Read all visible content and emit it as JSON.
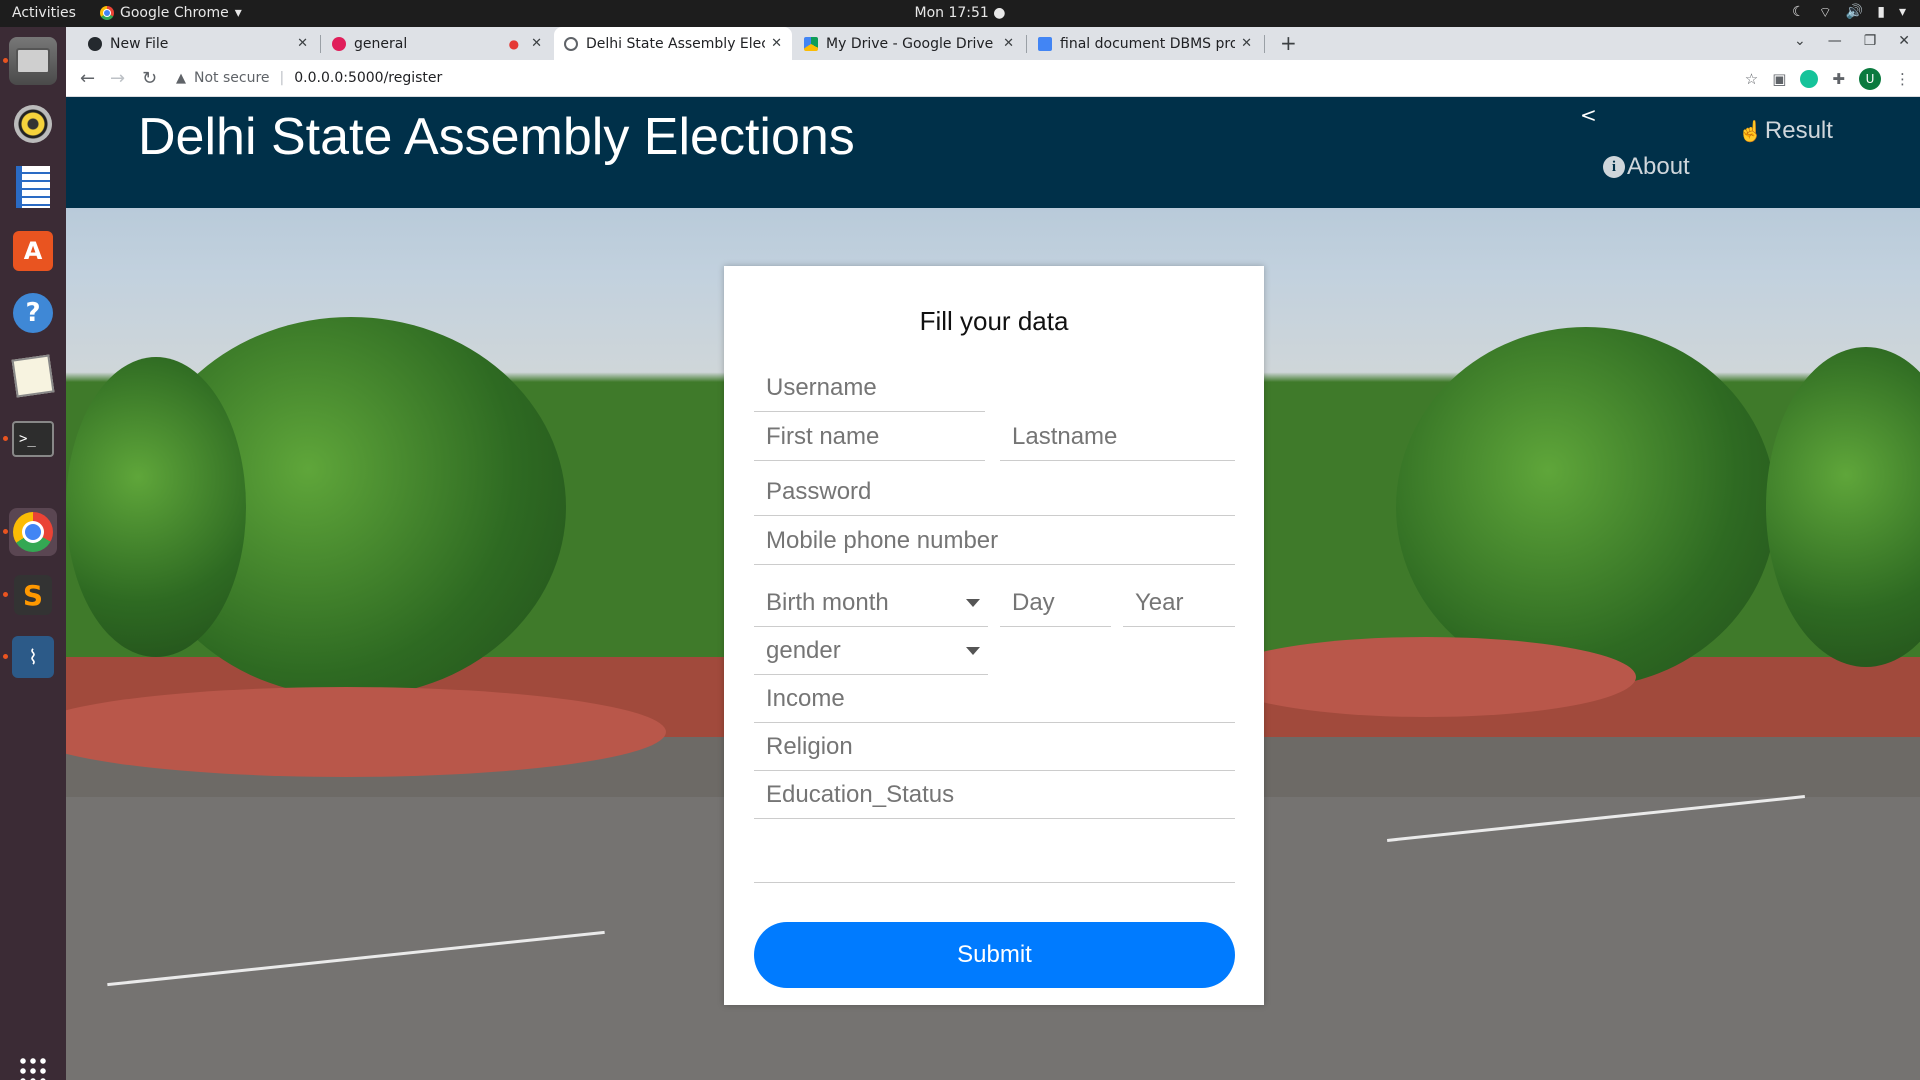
{
  "system": {
    "activities": "Activities",
    "app_menu": "Google Chrome",
    "clock": "Mon 17:51"
  },
  "browser": {
    "tabs": [
      {
        "title": "New File"
      },
      {
        "title": "general"
      },
      {
        "title": "Delhi State Assembly Elec"
      },
      {
        "title": "My Drive - Google Drive"
      },
      {
        "title": "final document DBMS pro"
      }
    ],
    "security": "Not secure",
    "url": "0.0.0.0:5000/register",
    "profile_initial": "U"
  },
  "header": {
    "title": "Delhi State Assembly Elections",
    "toggle": "<",
    "nav": {
      "result": "Result",
      "about": "About"
    }
  },
  "form": {
    "heading": "Fill your data",
    "placeholders": {
      "username": "Username",
      "first_name": "First name",
      "last_name": "Lastname",
      "password": "Password",
      "mobile": "Mobile phone number",
      "day": "Day",
      "year": "Year",
      "income": "Income",
      "religion": "Religion",
      "education": "Education_Status"
    },
    "birth_month": "Birth month",
    "gender": "gender",
    "submit": "Submit"
  },
  "colors": {
    "header_bg": "#003049",
    "submit_bg": "#007bff"
  }
}
